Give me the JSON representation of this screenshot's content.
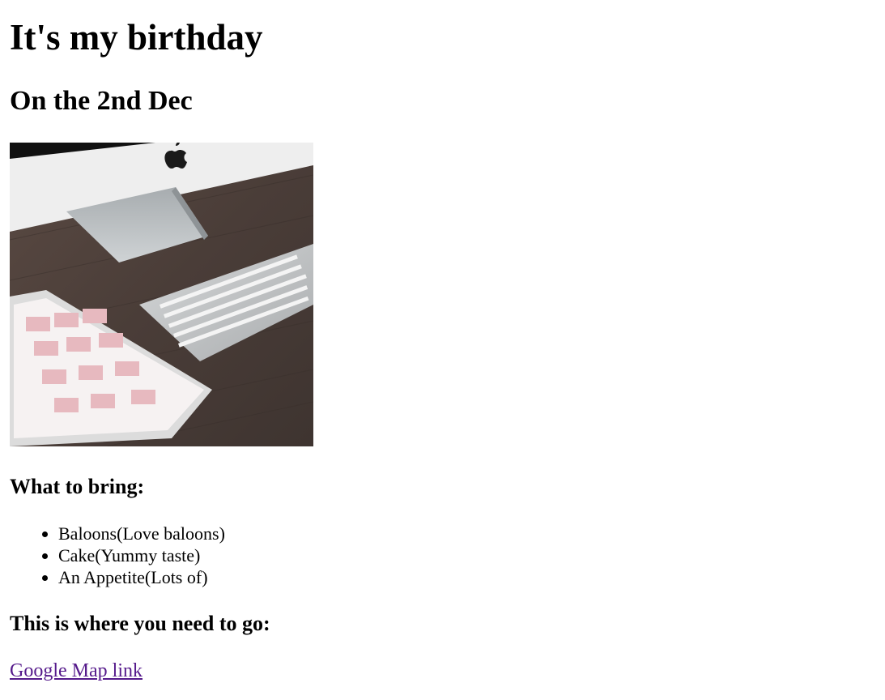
{
  "title": "It's my birthday",
  "subtitle": "On the 2nd Dec",
  "bring": {
    "heading": "What to bring:",
    "items": [
      "Baloons(Love baloons)",
      "Cake(Yummy taste)",
      "An Appetite(Lots of)"
    ]
  },
  "directions": {
    "heading": "This is where you need to go:",
    "link_text": "Google Map link"
  },
  "colors": {
    "link": "#551a8b",
    "desk": "#4a3f3a",
    "monitor": "#e8e8e8",
    "keyboard": "#c9cbcc"
  }
}
